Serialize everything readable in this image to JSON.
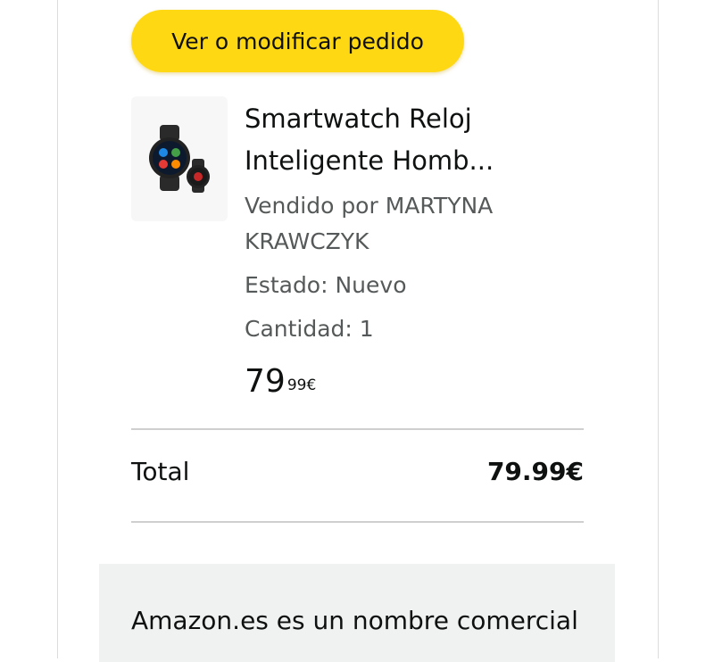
{
  "order": {
    "button_label": "Ver o modificar pedido"
  },
  "item": {
    "title_line1": "Smartwatch Reloj",
    "title_line2": "Inteligente Homb...",
    "seller_line1": "Vendido por MARTYNA",
    "seller_line2": "KRAWCZYK",
    "condition": "Estado: Nuevo",
    "quantity": "Cantidad: 1",
    "price_whole": "79",
    "price_fraction": "99€"
  },
  "summary": {
    "total_label": "Total",
    "total_value": "79.99€"
  },
  "footer": {
    "text": "Amazon.es es un nombre comercial"
  },
  "colors": {
    "button": "#ffd814",
    "muted_text": "#565959"
  }
}
